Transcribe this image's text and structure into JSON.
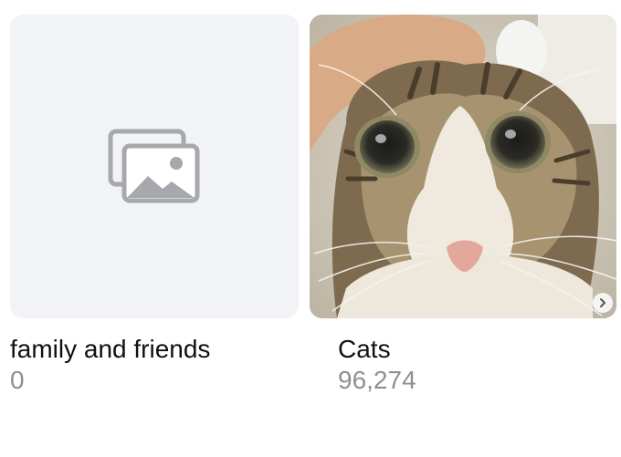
{
  "albums": [
    {
      "title": "family and friends",
      "count": "0",
      "thumbnail": "placeholder-photos-icon"
    },
    {
      "title": "Cats",
      "count": "96,274",
      "thumbnail": "cat-photo"
    }
  ],
  "icons": {
    "placeholder": "photos-placeholder-icon",
    "more": "chevron-right-icon"
  },
  "colors": {
    "title": "#111111",
    "count": "#8e8e93",
    "placeholder_bg": "#f2f3f7",
    "placeholder_icon": "#a7a8ad"
  }
}
